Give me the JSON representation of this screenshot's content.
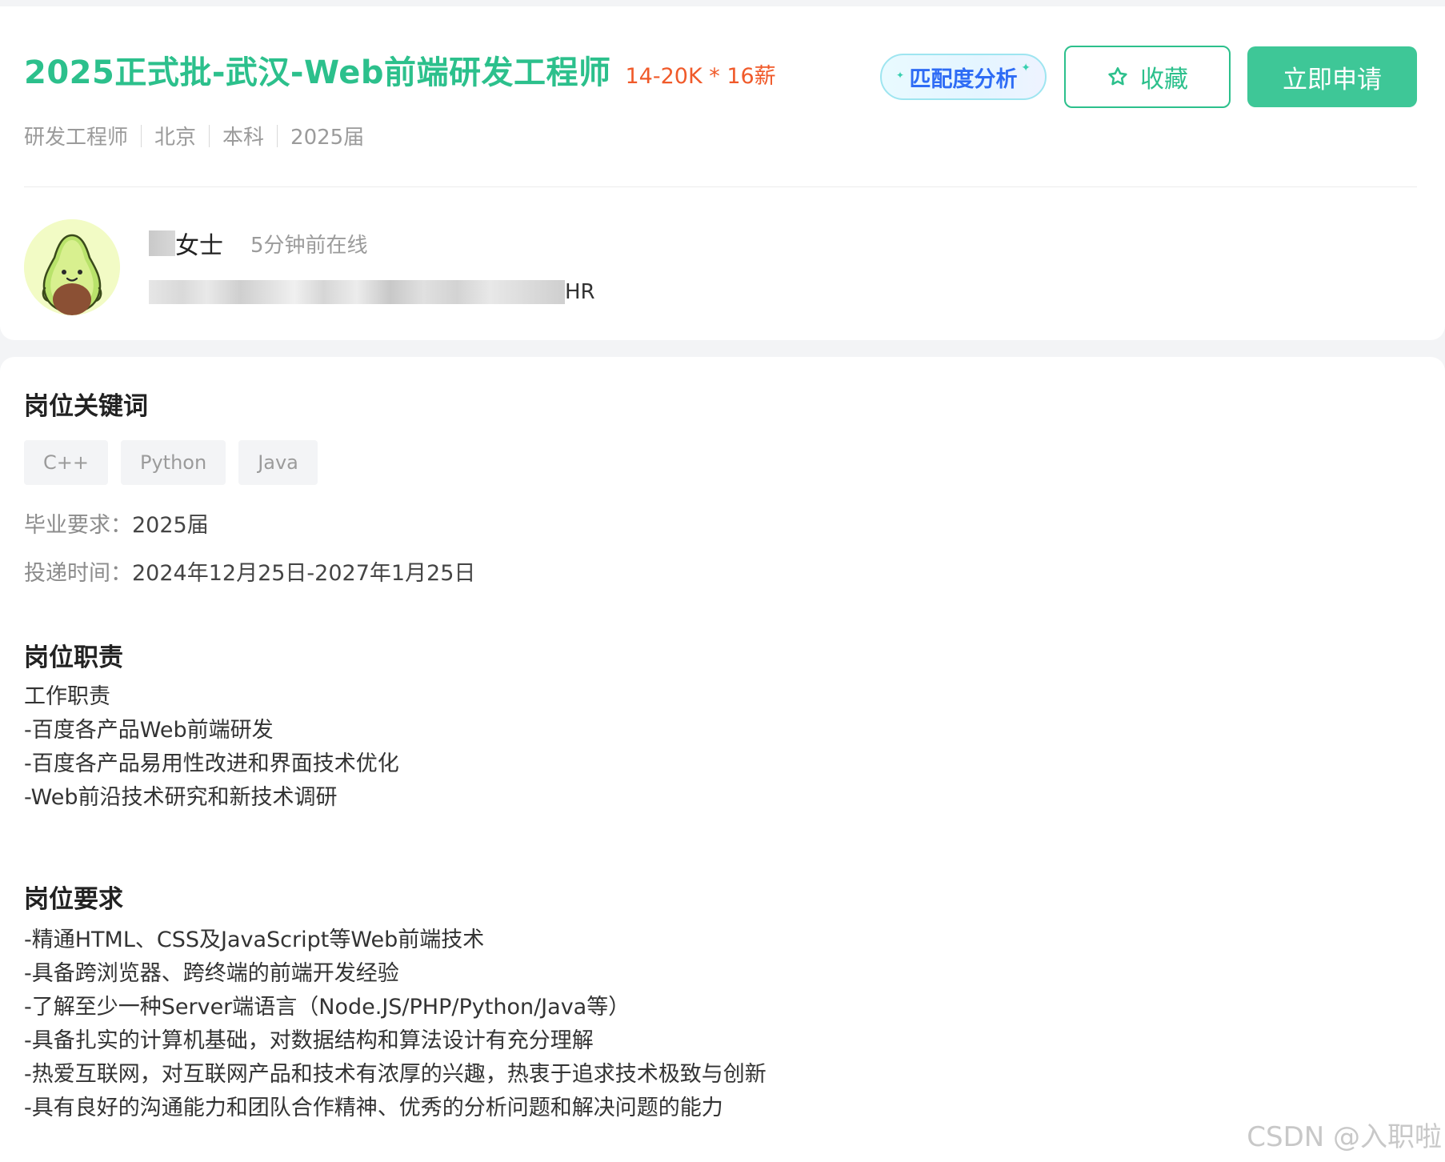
{
  "job": {
    "title": "2025正式批-武汉-Web前端研发工程师",
    "salary": "14-20K * 16薪",
    "meta": [
      "研发工程师",
      "北京",
      "本科",
      "2025届"
    ]
  },
  "actions": {
    "match_label": "匹配度分析",
    "favorite_label": "收藏",
    "apply_label": "立即申请"
  },
  "hr": {
    "name_suffix": "女士",
    "online_status": "5分钟前在线",
    "role_suffix": "HR"
  },
  "keywords": {
    "title": "岗位关键词",
    "tags": [
      "C++",
      "Python",
      "Java"
    ]
  },
  "requirements_info": {
    "graduation_label": "毕业要求：",
    "graduation_value": "2025届",
    "deadline_label": "投递时间：",
    "deadline_value": "2024年12月25日-2027年1月25日"
  },
  "duties": {
    "title": "岗位职责",
    "lines": [
      "工作职责",
      "-百度各产品Web前端研发",
      "-百度各产品易用性改进和界面技术优化",
      "-Web前沿技术研究和新技术调研"
    ]
  },
  "requirements": {
    "title": "岗位要求",
    "lines": [
      "-精通HTML、CSS及JavaScript等Web前端技术",
      "-具备跨浏览器、跨终端的前端开发经验",
      "-了解至少一种Server端语言（Node.JS/PHP/Python/Java等）",
      "-具备扎实的计算机基础，对数据结构和算法设计有充分理解",
      "-热爱互联网，对互联网产品和技术有浓厚的兴趣，热衷于追求技术极致与创新",
      "-具有良好的沟通能力和团队合作精神、优秀的分析问题和解决问题的能力"
    ]
  },
  "watermark": "CSDN @入职啦",
  "colors": {
    "brand_green": "#2cc08c",
    "salary_orange": "#f05a2a",
    "match_blue": "#2e6cf5"
  }
}
